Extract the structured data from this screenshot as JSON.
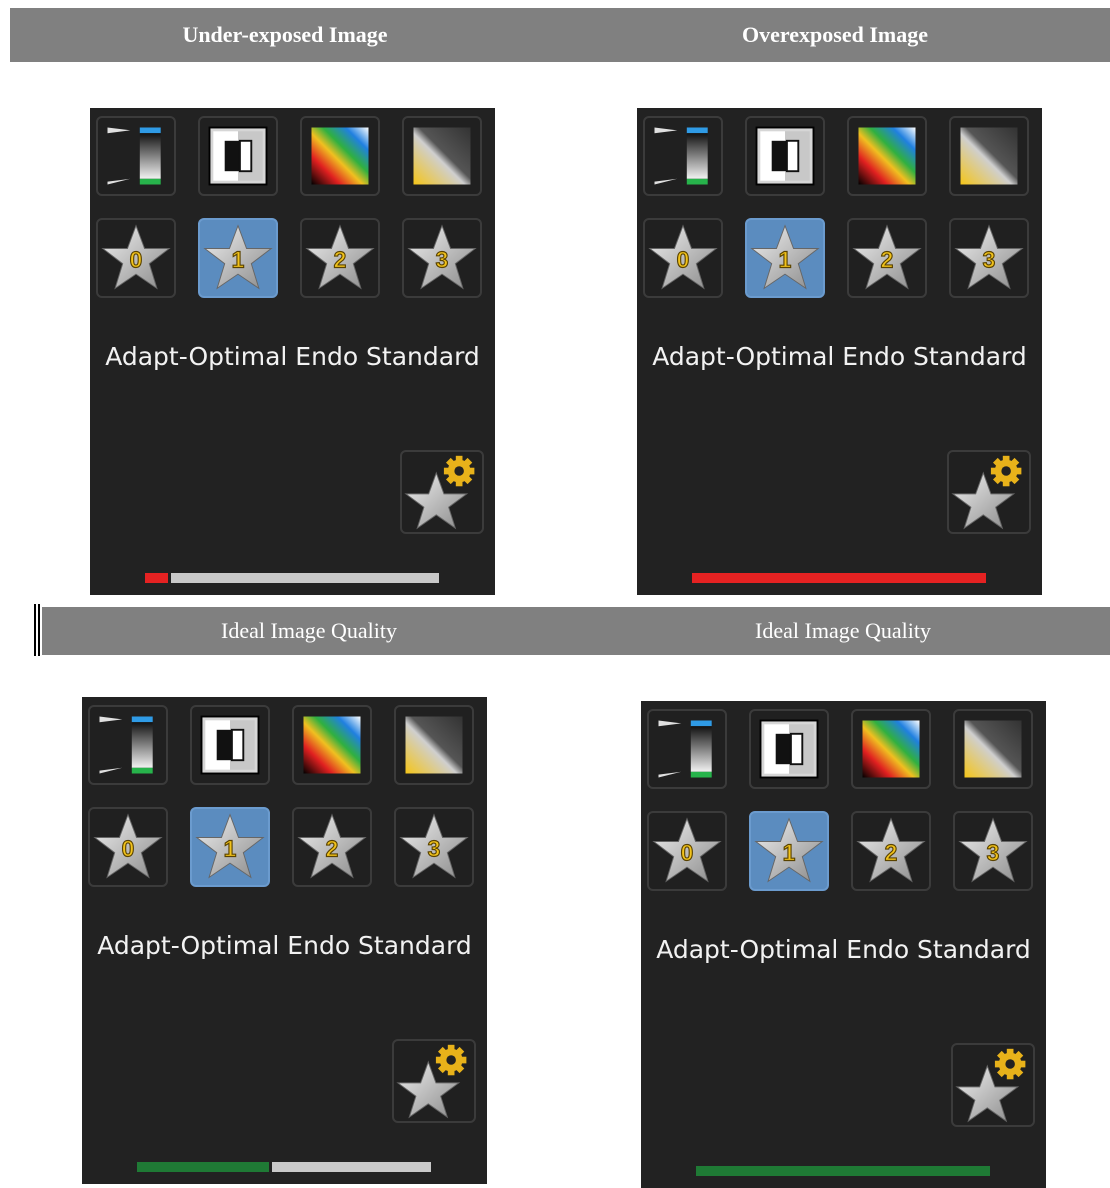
{
  "headers": {
    "top_left": "Under-exposed Image",
    "top_right": "Overexposed Image",
    "bottom_left": "Ideal Image Quality",
    "bottom_right": "Ideal Image Quality"
  },
  "panels": [
    {
      "preset_label": "Adapt-Optimal Endo Standard",
      "selected_preset": "1",
      "exposure_bar": {
        "filled_fraction": 0.09,
        "fill_color": "#e52222",
        "track_color": "#c9c9c9"
      }
    },
    {
      "preset_label": "Adapt-Optimal Endo Standard",
      "selected_preset": "1",
      "exposure_bar": {
        "filled_fraction": 1.0,
        "fill_color": "#e52222",
        "track_color": "#c9c9c9"
      }
    },
    {
      "preset_label": "Adapt-Optimal Endo Standard",
      "selected_preset": "1",
      "exposure_bar": {
        "filled_fraction": 0.46,
        "fill_color": "#1f7a35",
        "track_color": "#c9c9c9"
      }
    },
    {
      "preset_label": "Adapt-Optimal Endo Standard",
      "selected_preset": "1",
      "exposure_bar": {
        "filled_fraction": 1.0,
        "fill_color": "#1f7a35",
        "track_color": "#c9c9c9"
      }
    }
  ],
  "tools": [
    "window-level-icon",
    "invert-icon",
    "color-map-icon",
    "gamma-icon"
  ],
  "presets": [
    "0",
    "1",
    "2",
    "3"
  ],
  "colors": {
    "panel_bg": "#222222",
    "header_bg": "#808080",
    "selected_tile": "#5b8cbf",
    "star_number": "#f2c31b"
  }
}
